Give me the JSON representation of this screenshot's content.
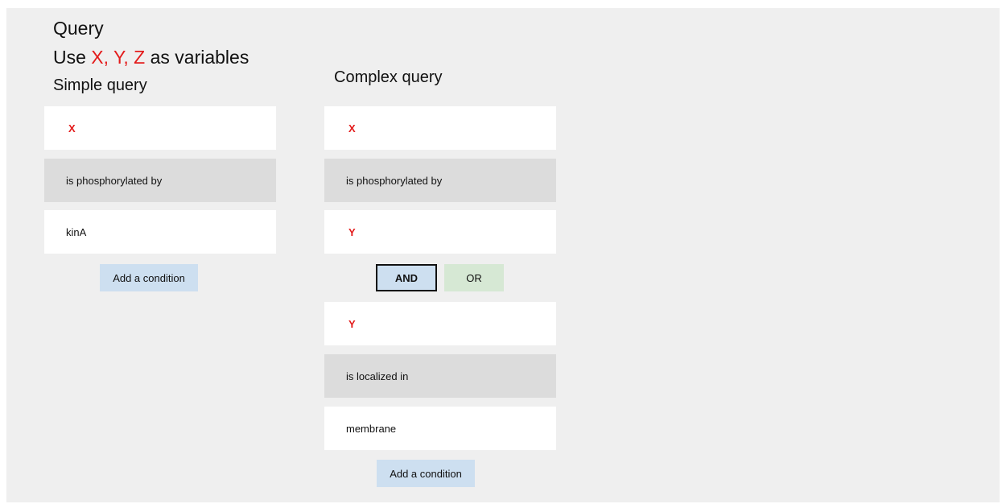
{
  "header": {
    "title": "Query",
    "hint_prefix": "Use ",
    "hint_vars": "X, Y, Z",
    "hint_suffix": " as variables"
  },
  "simple": {
    "heading": "Simple query",
    "rows": [
      "X",
      "is phosphorylated by",
      "kinA"
    ],
    "add_label": "Add a condition"
  },
  "complex": {
    "heading": "Complex query",
    "rows": [
      "X",
      "is phosphorylated by",
      "Y",
      "Y",
      "is localized in",
      "membrane"
    ],
    "and_label": "AND",
    "or_label": "OR",
    "add_label": "Add a condition"
  },
  "colors": {
    "variable": "#e31b1b",
    "predicate_bg": "#dcdcdc",
    "add_button_bg": "#cddff0",
    "or_button_bg": "#d6e8d4"
  }
}
